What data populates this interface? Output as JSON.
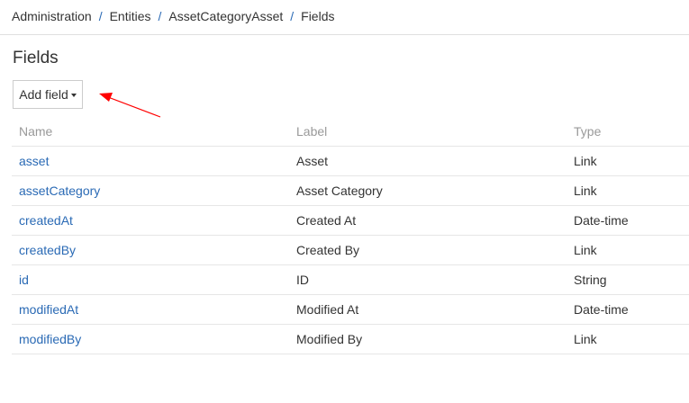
{
  "breadcrumb": {
    "items": [
      "Administration",
      "Entities",
      "AssetCategoryAsset",
      "Fields"
    ],
    "separator": "/"
  },
  "page": {
    "title": "Fields"
  },
  "toolbar": {
    "add_field_label": "Add field"
  },
  "table": {
    "headers": {
      "name": "Name",
      "label": "Label",
      "type": "Type"
    },
    "rows": [
      {
        "name": "asset",
        "label": "Asset",
        "type": "Link"
      },
      {
        "name": "assetCategory",
        "label": "Asset Category",
        "type": "Link"
      },
      {
        "name": "createdAt",
        "label": "Created At",
        "type": "Date-time"
      },
      {
        "name": "createdBy",
        "label": "Created By",
        "type": "Link"
      },
      {
        "name": "id",
        "label": "ID",
        "type": "String"
      },
      {
        "name": "modifiedAt",
        "label": "Modified At",
        "type": "Date-time"
      },
      {
        "name": "modifiedBy",
        "label": "Modified By",
        "type": "Link"
      }
    ]
  },
  "colors": {
    "link": "#2a6ab5",
    "annotation_arrow": "#ff0000",
    "header_text": "#999999"
  },
  "icons": {
    "add_field_caret": "caret-down-icon",
    "annotation": "red-arrow-icon"
  }
}
